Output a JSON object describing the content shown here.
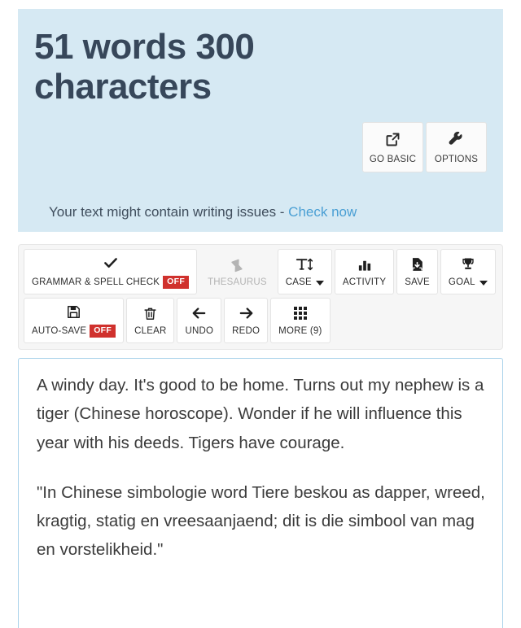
{
  "header": {
    "counter_text": "51 words 300 characters",
    "word_count": 51,
    "character_count": 300,
    "buttons": [
      {
        "label": "GO BASIC",
        "icon": "external-link-icon"
      },
      {
        "label": "OPTIONS",
        "icon": "wrench-icon"
      }
    ],
    "issues_prefix": "Your text might contain writing issues - ",
    "issues_link": "Check now",
    "background_color": "#d6e9f3",
    "title_color": "#37475a",
    "link_color": "#4a9fd4"
  },
  "toolbar": {
    "row1": [
      {
        "label": "GRAMMAR & SPELL CHECK",
        "icon": "check-icon",
        "badge": "OFF",
        "disabled": false
      },
      {
        "label": "THESAURUS",
        "icon": "book-icon",
        "badge": "",
        "disabled": true
      },
      {
        "label": "CASE",
        "icon": "text-height-icon",
        "badge": "",
        "caret": true,
        "disabled": false
      },
      {
        "label": "ACTIVITY",
        "icon": "bar-chart-icon",
        "badge": "",
        "disabled": false
      },
      {
        "label": "SAVE",
        "icon": "file-download-icon",
        "badge": "",
        "disabled": false
      },
      {
        "label": "GOAL",
        "icon": "trophy-icon",
        "badge": "",
        "caret": true,
        "disabled": false
      }
    ],
    "row2": [
      {
        "label": "AUTO-SAVE",
        "icon": "floppy-disk-icon",
        "badge": "OFF",
        "disabled": false
      },
      {
        "label": "CLEAR",
        "icon": "trash-icon",
        "badge": "",
        "disabled": false
      },
      {
        "label": "UNDO",
        "icon": "arrow-left-icon",
        "badge": "",
        "disabled": false
      },
      {
        "label": "REDO",
        "icon": "arrow-right-icon",
        "badge": "",
        "disabled": false
      },
      {
        "label": "MORE (9)",
        "icon": "grid-dots-icon",
        "badge": "",
        "disabled": false
      }
    ],
    "badge_color": "#d0312d"
  },
  "editor": {
    "paragraph1": "A windy day. It's good to be home. Turns out my nephew is a tiger (Chinese horoscope). Wonder if he will influence this year with his deeds. Tigers have  courage.",
    "paragraph2": "\"In Chinese simbologie word Tiere beskou as dapper, wreed, kragtig, statig en vreesaanjaend; dit is die simbool van mag en vorstelikheid.\"",
    "border_color": "#a8d2ea"
  }
}
